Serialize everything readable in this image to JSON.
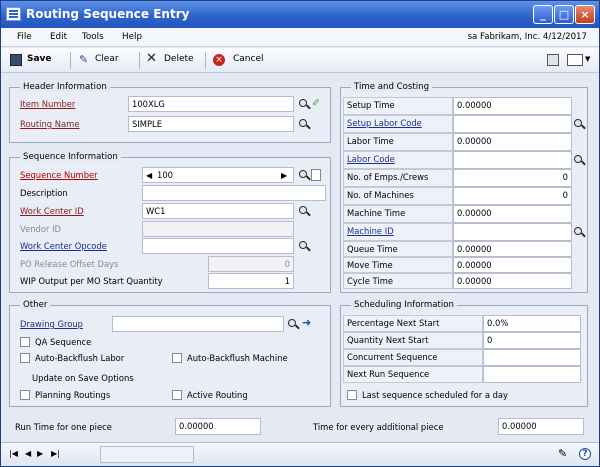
{
  "window": {
    "title": "Routing Sequence Entry",
    "min": "_",
    "max": "□",
    "close": "×"
  },
  "menu": [
    "File",
    "Edit",
    "Tools",
    "Help"
  ],
  "company": "sa Fabrikam, Inc. 4/12/2017",
  "toolbar": {
    "save": "Save",
    "clear": "Clear",
    "delete": "Delete",
    "cancel": "Cancel"
  },
  "header": {
    "legend": "Header Information",
    "item_number_label": "Item Number",
    "item_number": "100XLG",
    "routing_name_label": "Routing Name",
    "routing_name": "SIMPLE"
  },
  "sequence": {
    "legend": "Sequence Information",
    "seq_label": "Sequence Number",
    "seq": "100",
    "desc_label": "Description",
    "desc": "",
    "wc_label": "Work Center ID",
    "wc": "WC1",
    "vendor_label": "Vendor ID",
    "vendor": "",
    "opcode_label": "Work Center Opcode",
    "opcode": "",
    "po_label": "PO Release Offset Days",
    "po": "0",
    "wip_label": "WIP Output per MO Start Quantity",
    "wip": "1"
  },
  "time": {
    "legend": "Time and Costing",
    "setup_time_label": "Setup Time",
    "setup_time": "0.00000",
    "setup_labor_label": "Setup Labor Code",
    "setup_labor": "",
    "labor_time_label": "Labor Time",
    "labor_time": "0.00000",
    "labor_code_label": "Labor Code",
    "labor_code": "",
    "emps_label": "No. of Emps./Crews",
    "emps": "0",
    "machines_label": "No. of Machines",
    "machines": "0",
    "machine_time_label": "Machine Time",
    "machine_time": "0.00000",
    "machine_id_label": "Machine ID",
    "machine_id": "",
    "queue_label": "Queue Time",
    "queue": "0.00000",
    "move_label": "Move Time",
    "move": "0.00000",
    "cycle_label": "Cycle Time",
    "cycle": "0.00000"
  },
  "other": {
    "legend": "Other",
    "drawing_label": "Drawing Group",
    "drawing": "",
    "qa": "QA Sequence",
    "abl": "Auto-Backflush Labor",
    "abm": "Auto-Backflush Machine",
    "update": "Update on Save Options",
    "planning": "Planning Routings",
    "active": "Active Routing"
  },
  "sched": {
    "legend": "Scheduling Information",
    "pct_label": "Percentage Next Start",
    "pct": "0.0%",
    "qty_label": "Quantity Next Start",
    "qty": "0",
    "conc_label": "Concurrent Sequence",
    "conc": "",
    "next_label": "Next Run Sequence",
    "next": "",
    "last": "Last sequence scheduled for a day"
  },
  "bottom": {
    "run_label": "Run Time for one piece",
    "run": "0.00000",
    "add_label": "Time for every additional piece",
    "add": "0.00000"
  }
}
